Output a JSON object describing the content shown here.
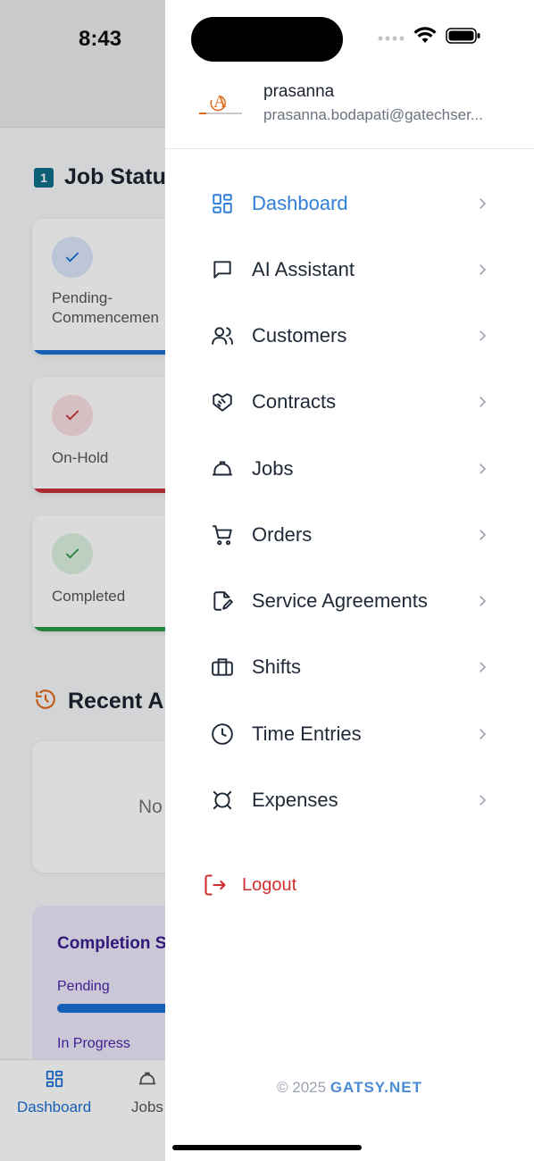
{
  "status_bar": {
    "time": "8:43"
  },
  "dashboard": {
    "job_status": {
      "badge": "1",
      "title": "Job Statu"
    },
    "cards": [
      {
        "label": "Pending-\nCommencemen",
        "color": "#1a6fd6",
        "circle_bg": "#dbe7fb",
        "check_color": "#1a6fd6"
      },
      {
        "label": "On-Hold",
        "color": "#c8313a",
        "circle_bg": "#f8dfe2",
        "check_color": "#c8313a"
      },
      {
        "label": "Completed",
        "color": "#2e9a48",
        "circle_bg": "#dcf1e0",
        "check_color": "#2e9a48"
      }
    ],
    "recent": {
      "title": "Recent A",
      "empty_text": "No"
    },
    "completion": {
      "title": "Completion S",
      "rows": [
        {
          "label": "Pending",
          "color": "#1a6fd6"
        },
        {
          "label": "In Progress",
          "color": "#e3a51c"
        }
      ]
    },
    "bottom_tabs": [
      {
        "label": "Dashboard",
        "icon": "grid-icon",
        "active": true
      },
      {
        "label": "Jobs",
        "icon": "hardhat-icon",
        "active": false
      }
    ]
  },
  "drawer": {
    "user": {
      "name": "prasanna",
      "email": "prasanna.bodapati@gatechser..."
    },
    "menu": [
      {
        "label": "Dashboard",
        "icon": "grid-icon",
        "active": true
      },
      {
        "label": "AI Assistant",
        "icon": "chat-icon",
        "active": false
      },
      {
        "label": "Customers",
        "icon": "users-icon",
        "active": false
      },
      {
        "label": "Contracts",
        "icon": "handshake-icon",
        "active": false
      },
      {
        "label": "Jobs",
        "icon": "hardhat-icon",
        "active": false
      },
      {
        "label": "Orders",
        "icon": "cart-icon",
        "active": false
      },
      {
        "label": "Service Agreements",
        "icon": "document-edit-icon",
        "active": false
      },
      {
        "label": "Shifts",
        "icon": "briefcase-icon",
        "active": false
      },
      {
        "label": "Time Entries",
        "icon": "clock-icon",
        "active": false
      },
      {
        "label": "Expenses",
        "icon": "currency-icon",
        "active": false
      }
    ],
    "logout_label": "Logout",
    "footer": {
      "copyright": "© 2025",
      "brand": "GATSY.NET"
    }
  },
  "colors": {
    "accent": "#2f7ed8",
    "logout": "#d03030",
    "text": "#1f2937"
  }
}
